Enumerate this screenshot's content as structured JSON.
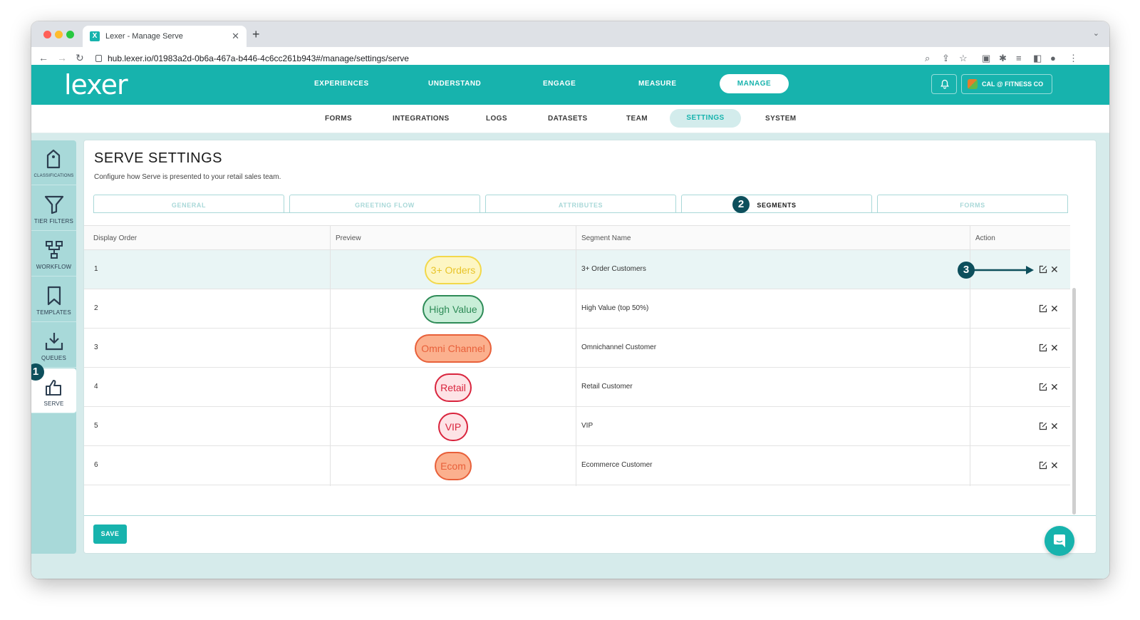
{
  "browser": {
    "tab_title": "Lexer - Manage Serve",
    "favicon_letter": "X",
    "url": "hub.lexer.io/01983a2d-0b6a-467a-b446-4c6cc261b943#/manage/settings/serve"
  },
  "app": {
    "logo": "lexer",
    "top_nav": [
      "EXPERIENCES",
      "UNDERSTAND",
      "ENGAGE",
      "MEASURE",
      "MANAGE"
    ],
    "top_nav_active": "MANAGE",
    "account_label": "CAL @ FITNESS CO",
    "sub_nav": [
      "FORMS",
      "INTEGRATIONS",
      "LOGS",
      "DATASETS",
      "TEAM",
      "SETTINGS",
      "SYSTEM"
    ],
    "sub_nav_active": "SETTINGS"
  },
  "sidebar": {
    "items": [
      {
        "label": "CLASSIFICATIONS",
        "icon": "tag-icon"
      },
      {
        "label": "TIER FILTERS",
        "icon": "filter-icon"
      },
      {
        "label": "WORKFLOW",
        "icon": "workflow-icon"
      },
      {
        "label": "TEMPLATES",
        "icon": "bookmark-icon"
      },
      {
        "label": "QUEUES",
        "icon": "download-tray-icon"
      },
      {
        "label": "SERVE",
        "icon": "thumbs-up-icon"
      }
    ],
    "active": "SERVE"
  },
  "page": {
    "title": "SERVE SETTINGS",
    "subtitle": "Configure how Serve is presented to your retail sales team.",
    "tabs": [
      "GENERAL",
      "GREETING FLOW",
      "ATTRIBUTES",
      "SEGMENTS",
      "FORMS"
    ],
    "active_tab": "SEGMENTS",
    "save_label": "SAVE"
  },
  "table": {
    "headers": [
      "Display Order",
      "Preview",
      "Segment Name",
      "Action"
    ],
    "rows": [
      {
        "order": "1",
        "preview": "3+ Orders",
        "name": "3+ Order Customers",
        "pill_bg": "#fdf6c4",
        "pill_border": "#f2d84a",
        "pill_text": "#e8c42a"
      },
      {
        "order": "2",
        "preview": "High Value",
        "name": "High Value (top 50%)",
        "pill_bg": "#c9eed8",
        "pill_border": "#2e8b57",
        "pill_text": "#2e8b57"
      },
      {
        "order": "3",
        "preview": "Omni Channel",
        "name": "Omnichannel Customer",
        "pill_bg": "#fbb08e",
        "pill_border": "#e8603a",
        "pill_text": "#e8603a"
      },
      {
        "order": "4",
        "preview": "Retail",
        "name": "Retail Customer",
        "pill_bg": "#fde3e6",
        "pill_border": "#d9243d",
        "pill_text": "#d9243d"
      },
      {
        "order": "5",
        "preview": "VIP",
        "name": "VIP",
        "pill_bg": "#fde3e6",
        "pill_border": "#d9243d",
        "pill_text": "#d9243d"
      },
      {
        "order": "6",
        "preview": "Ecom",
        "name": "Ecommerce Customer",
        "pill_bg": "#fbb08e",
        "pill_border": "#e8603a",
        "pill_text": "#e8603a"
      }
    ]
  },
  "annotations": {
    "markers": [
      "1",
      "2",
      "3"
    ]
  },
  "colors": {
    "brand": "#17b3ad",
    "marker": "#0d4f5c"
  }
}
